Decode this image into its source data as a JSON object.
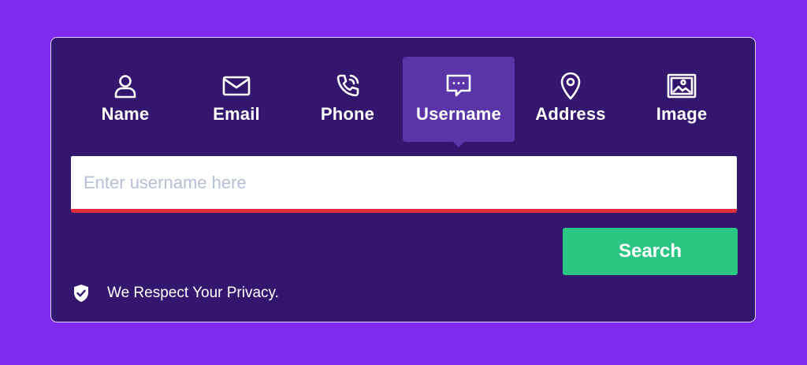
{
  "tabs": [
    {
      "label": "Name",
      "icon": "user-icon"
    },
    {
      "label": "Email",
      "icon": "envelope-icon"
    },
    {
      "label": "Phone",
      "icon": "phone-icon"
    },
    {
      "label": "Username",
      "icon": "chat-bubble-icon"
    },
    {
      "label": "Address",
      "icon": "map-pin-icon"
    },
    {
      "label": "Image",
      "icon": "image-icon"
    }
  ],
  "active_tab": "Username",
  "search": {
    "placeholder": "Enter username here",
    "value": "",
    "button_label": "Search"
  },
  "privacy": {
    "text": "We Respect Your Privacy.",
    "icon": "shield-check-icon"
  },
  "colors": {
    "page_background": "#7f2bef",
    "card_background": "#33166e",
    "active_tab": "#5a35a8",
    "input_underline": "#e32b3e",
    "search_button": "#2bc683"
  }
}
